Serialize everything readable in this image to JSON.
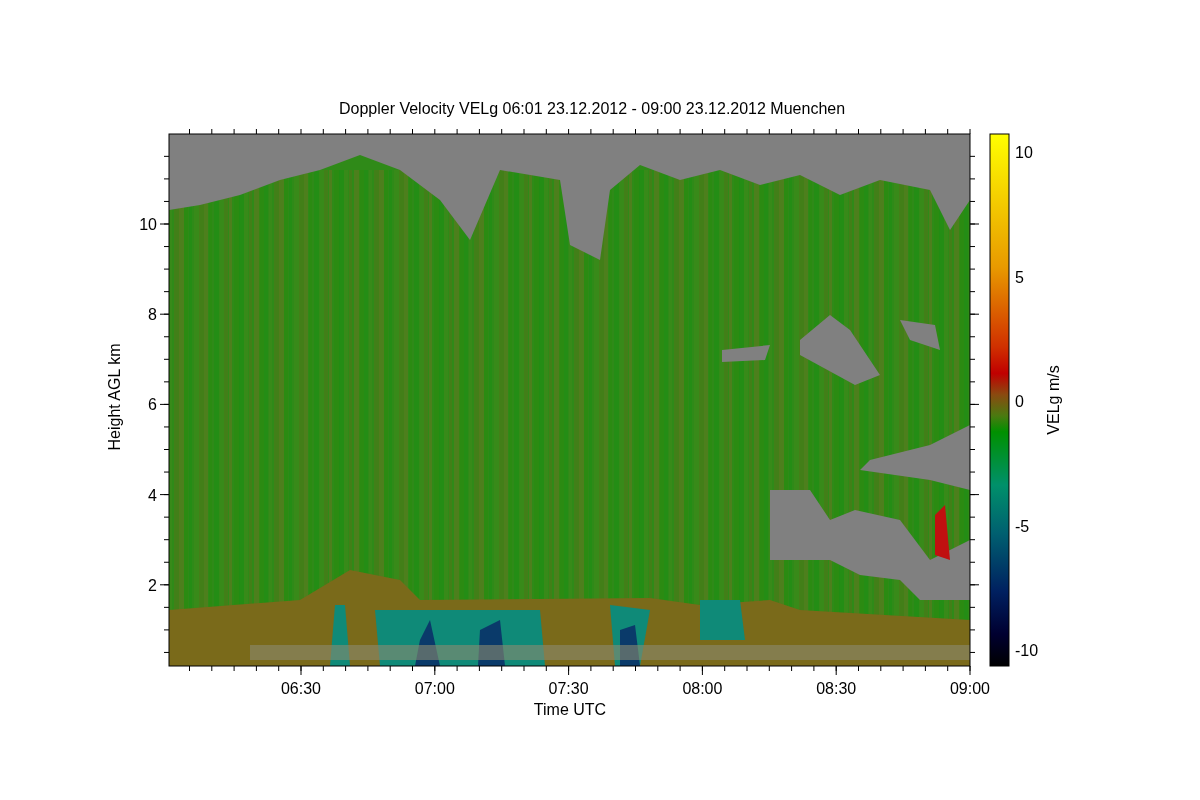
{
  "plot": {
    "title": "Doppler Velocity VELg   06:01 23.12.2012 - 09:00 23.12.2012 Muenchen",
    "y_axis": {
      "label": "Height AGL km",
      "ticks": [
        "10",
        "8",
        "6",
        "4",
        "2"
      ]
    },
    "x_axis": {
      "label": "Time UTC",
      "ticks": [
        "06:30",
        "07:00",
        "07:30",
        "08:00",
        "08:30",
        "09:00"
      ]
    },
    "colorbar": {
      "label": "VELg m/s",
      "ticks": [
        "10",
        "5",
        "0",
        "-5",
        "-10"
      ]
    }
  }
}
